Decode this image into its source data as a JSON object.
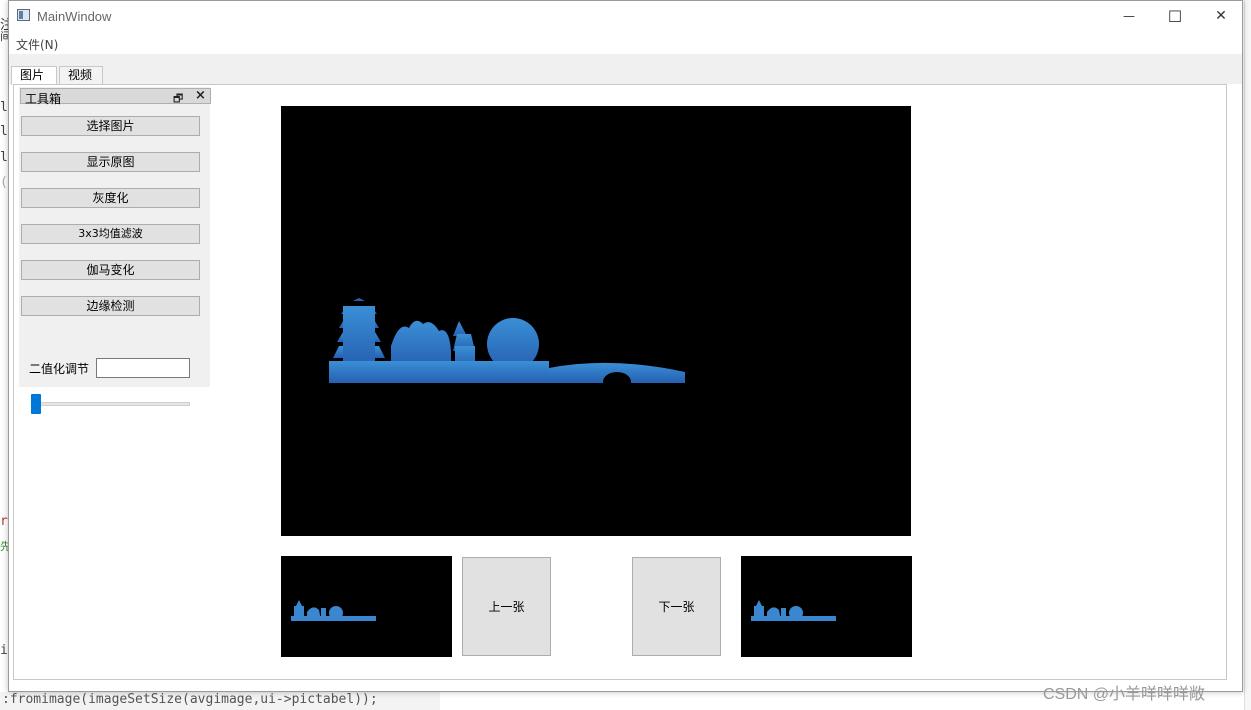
{
  "window": {
    "title": "MainWindow",
    "controls": {
      "minimize": "—",
      "maximize": "☐",
      "close": "✕"
    }
  },
  "menubar": {
    "file_menu": "文件(N)"
  },
  "tabs": [
    {
      "label": "图片",
      "active": true
    },
    {
      "label": "视频",
      "active": false
    }
  ],
  "toolbox": {
    "title": "工具箱",
    "float_icon": "restore-icon",
    "close_icon": "close-icon",
    "buttons": [
      "选择图片",
      "显示原图",
      "灰度化",
      "3x3均值滤波",
      "伽马变化",
      "边缘检测"
    ]
  },
  "binarize": {
    "label": "二值化调节",
    "input_value": "",
    "slider_value": 0
  },
  "navigation": {
    "prev_label": "上一张",
    "next_label": "下一张"
  },
  "image": {
    "description": "skyline silhouette",
    "fill_color": "#2f7fc8"
  },
  "watermark": "CSDN @小羊咩咩咩敞",
  "background_code": {
    "bottom_line": ":fromimage(imageSetSize(avgimage,ui->pictabel));",
    "side_chars": [
      "注",
      "间",
      "l",
      "l",
      "l",
      "(",
      "r",
      "先",
      "i"
    ]
  }
}
